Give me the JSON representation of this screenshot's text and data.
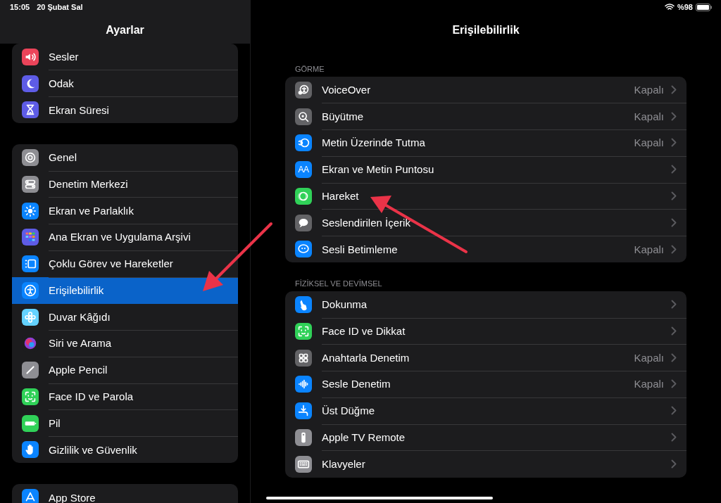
{
  "status_bar": {
    "time": "15:05",
    "date": "20 Şubat Sal",
    "battery_text": "%98"
  },
  "sidebar": {
    "title": "Ayarlar",
    "groups": [
      {
        "items": [
          {
            "label": "Sesler",
            "selected": false
          },
          {
            "label": "Odak",
            "selected": false
          },
          {
            "label": "Ekran Süresi",
            "selected": false
          }
        ]
      },
      {
        "items": [
          {
            "label": "Genel",
            "selected": false
          },
          {
            "label": "Denetim Merkezi",
            "selected": false
          },
          {
            "label": "Ekran ve Parlaklık",
            "selected": false
          },
          {
            "label": "Ana Ekran ve Uygulama Arşivi",
            "selected": false
          },
          {
            "label": "Çoklu Görev ve Hareketler",
            "selected": false
          },
          {
            "label": "Erişilebilirlik",
            "selected": true
          },
          {
            "label": "Duvar Kâğıdı",
            "selected": false
          },
          {
            "label": "Siri ve Arama",
            "selected": false
          },
          {
            "label": "Apple Pencil",
            "selected": false
          },
          {
            "label": "Face ID ve Parola",
            "selected": false
          },
          {
            "label": "Pil",
            "selected": false
          },
          {
            "label": "Gizlilik ve Güvenlik",
            "selected": false
          }
        ]
      },
      {
        "items": [
          {
            "label": "App Store",
            "selected": false
          }
        ]
      }
    ]
  },
  "detail": {
    "title": "Erişilebilirlik",
    "sections": [
      {
        "header": "GÖRME",
        "rows": [
          {
            "label": "VoiceOver",
            "value": "Kapalı"
          },
          {
            "label": "Büyütme",
            "value": "Kapalı"
          },
          {
            "label": "Metin Üzerinde Tutma",
            "value": "Kapalı"
          },
          {
            "label": "Ekran ve Metin Puntosu",
            "icon_text": "AA"
          },
          {
            "label": "Hareket"
          },
          {
            "label": "Seslendirilen İçerik"
          },
          {
            "label": "Sesli Betimleme",
            "value": "Kapalı"
          }
        ]
      },
      {
        "header": "FİZİKSEL VE DEVİMSEL",
        "rows": [
          {
            "label": "Dokunma"
          },
          {
            "label": "Face ID ve Dikkat"
          },
          {
            "label": "Anahtarla Denetim",
            "value": "Kapalı"
          },
          {
            "label": "Sesle Denetim",
            "value": "Kapalı"
          },
          {
            "label": "Üst Düğme"
          },
          {
            "label": "Apple TV Remote"
          },
          {
            "label": "Klavyeler"
          }
        ]
      }
    ]
  }
}
